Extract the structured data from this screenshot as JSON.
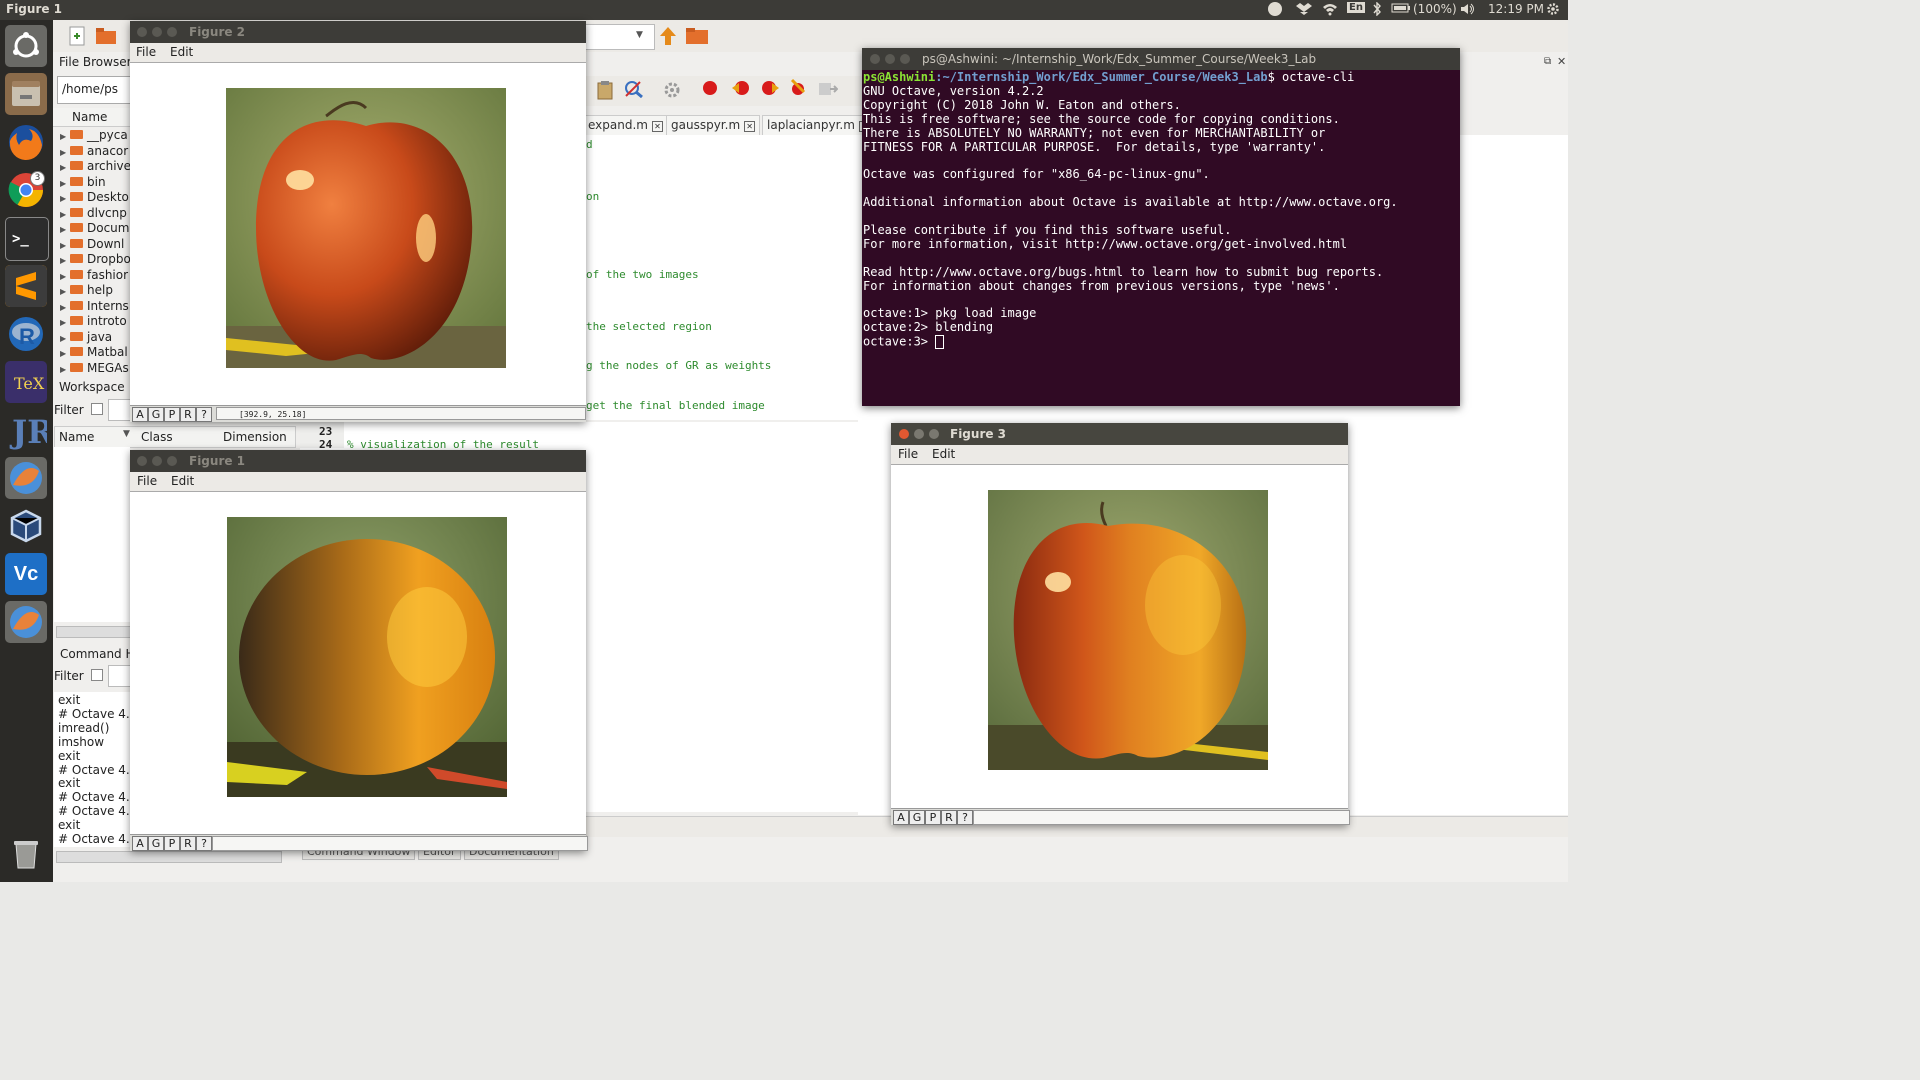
{
  "topbar": {
    "title": "Figure 1",
    "indicators": {
      "mail": "M",
      "keyboard": "En",
      "battery": "(100%)",
      "time": "12:19 PM"
    }
  },
  "launcher": {
    "chrome_badge": "3"
  },
  "octave_gui": {
    "file_browser_label": "File Browser",
    "path": "/home/ps",
    "name_header": "Name",
    "tree_items": [
      "__pyca",
      "anacor",
      "archive",
      "bin",
      "Deskto",
      "dlvcnp",
      "Docum",
      "Downl",
      "Dropbo",
      "fashior",
      "help",
      "Interns",
      "introto",
      "java",
      "Matbal",
      "MEGAs"
    ],
    "workspace_label": "Workspace",
    "filter_label": "Filter",
    "ws_columns": {
      "name": "Name",
      "class": "Class",
      "dimension": "Dimension"
    },
    "command_history_label": "Command Hi",
    "history_filter_label": "Filter",
    "history_items": [
      "exit",
      "# Octave 4.2.",
      "imread()",
      "imshow",
      "exit",
      "# Octave 4.2.",
      "exit",
      "# Octave 4.2.",
      "# Octave 4.2.",
      "exit",
      "# Octave 4.2."
    ],
    "editor_tabs": [
      "expand.m",
      "gausspyr.m",
      "laplacianpyr.m"
    ],
    "line_numbers": [
      "23",
      "24"
    ],
    "code_fragments": [
      "d",
      "on",
      "of the two images",
      " the selected region",
      "g the nodes of GR as weights",
      " get the final blended image",
      "% visualization of the result"
    ],
    "bottom_tabs": [
      "Command Window",
      "Editor",
      "Documentation"
    ]
  },
  "figure2": {
    "title": "Figure 2",
    "menu": {
      "file": "File",
      "edit": "Edit"
    },
    "status_buttons": [
      "A",
      "G",
      "P",
      "R",
      "?"
    ],
    "coords": "[392.9, 25.18]"
  },
  "figure1": {
    "title": "Figure 1",
    "menu": {
      "file": "File",
      "edit": "Edit"
    },
    "status_buttons": [
      "A",
      "G",
      "P",
      "R",
      "?"
    ]
  },
  "figure3": {
    "title": "Figure 3",
    "menu": {
      "file": "File",
      "edit": "Edit"
    },
    "status_buttons": [
      "A",
      "G",
      "P",
      "R",
      "?"
    ]
  },
  "terminal": {
    "title": "ps@Ashwini: ~/Internship_Work/Edx_Summer_Course/Week3_Lab",
    "prompt_user": "ps@Ashwini",
    "prompt_path": ":~/Internship_Work/Edx_Summer_Course/Week3_Lab",
    "prompt_cmd": "$ octave-cli",
    "lines": [
      "GNU Octave, version 4.2.2",
      "Copyright (C) 2018 John W. Eaton and others.",
      "This is free software; see the source code for copying conditions.",
      "There is ABSOLUTELY NO WARRANTY; not even for MERCHANTABILITY or",
      "FITNESS FOR A PARTICULAR PURPOSE.  For details, type 'warranty'.",
      "",
      "Octave was configured for \"x86_64-pc-linux-gnu\".",
      "",
      "Additional information about Octave is available at http://www.octave.org.",
      "",
      "Please contribute if you find this software useful.",
      "For more information, visit http://www.octave.org/get-involved.html",
      "",
      "Read http://www.octave.org/bugs.html to learn how to submit bug reports.",
      "For information about changes from previous versions, type 'news'.",
      "",
      "octave:1> pkg load image",
      "octave:2> blending"
    ],
    "last_prompt": "octave:3> "
  }
}
